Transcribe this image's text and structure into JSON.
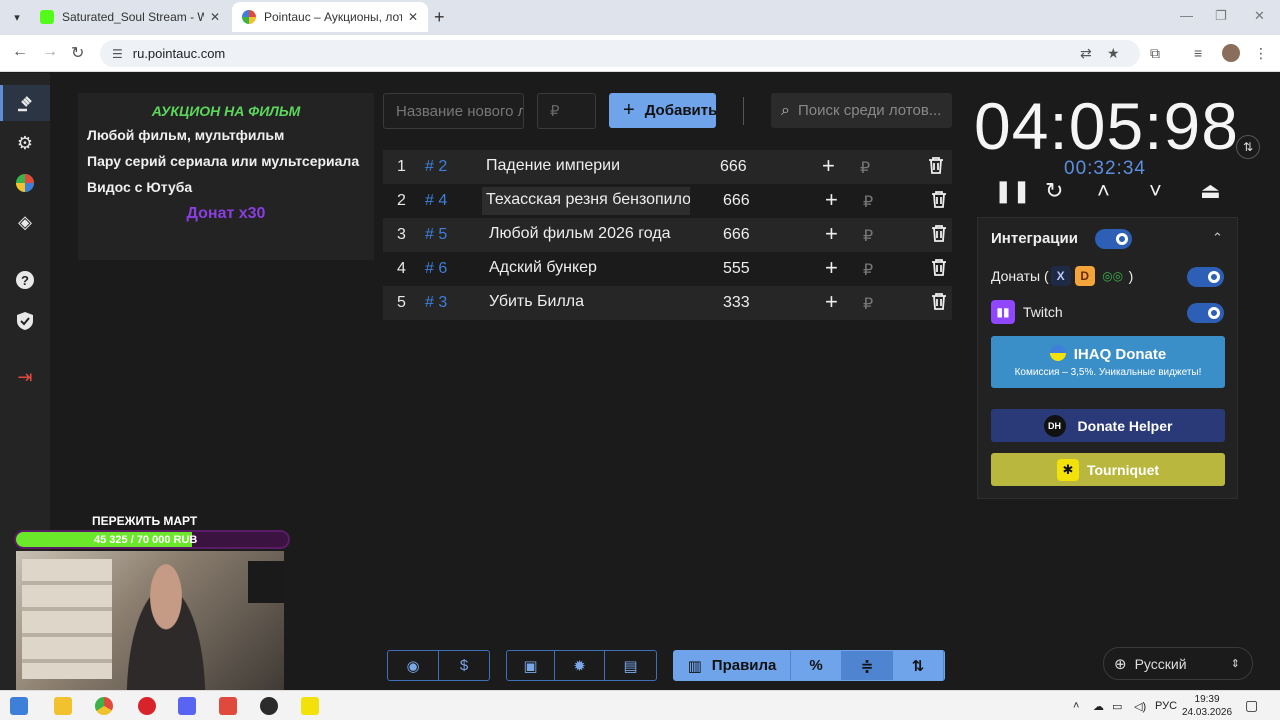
{
  "browser": {
    "tabs": [
      {
        "title": "Saturated_Soul Stream - Watch",
        "favicon_color": "#53fc18"
      },
      {
        "title": "Pointauc – Аукционы, лотереи",
        "favicon_color": "#e04a3c"
      }
    ],
    "url": "ru.pointauc.com"
  },
  "nav": {
    "items": [
      "auction-icon",
      "settings-icon",
      "wheel-icon",
      "layers-icon",
      "help-icon",
      "shield-icon",
      "logout-icon"
    ]
  },
  "note": {
    "heading": "АУКЦИОН НА ФИЛЬМ",
    "lines": [
      "Любой фильм, мультфильм",
      "Пару серий сериала или мультсериала",
      "Видос с Ютуба"
    ],
    "donate": "Донат х30"
  },
  "controls": {
    "name_placeholder": "Название нового лота",
    "amount_placeholder": "₽",
    "add_label": "Добавить",
    "search_placeholder": "Поиск среди лотов..."
  },
  "lots": [
    {
      "rank": "1",
      "id": "# 2",
      "name": "Падение империи",
      "amount": "666",
      "currency": "₽"
    },
    {
      "rank": "2",
      "id": "# 4",
      "name": "Техасская резня бензопилой",
      "amount": "666",
      "currency": "₽"
    },
    {
      "rank": "3",
      "id": "# 5",
      "name": "Любой фильм 2026 года",
      "amount": "666",
      "currency": "₽"
    },
    {
      "rank": "4",
      "id": "# 6",
      "name": "Адский бункер",
      "amount": "555",
      "currency": "₽"
    },
    {
      "rank": "5",
      "id": "# 3",
      "name": "Убить Билла",
      "amount": "333",
      "currency": "₽"
    }
  ],
  "timer": {
    "main": "04:05:98",
    "sub": "00:32:34"
  },
  "integrations": {
    "title": "Интеграции",
    "donations_label": "Донаты (",
    "donations_close": ")",
    "twitch_label": "Twitch",
    "ihaq_title": "IHAQ Donate",
    "ihaq_sub": "Комиссия – 3,5%. Уникальные виджеты!",
    "donate_helper": "Donate Helper",
    "donate_helper_logo": "DH",
    "tourniquet": "Tourniquet",
    "toggles_on": [
      true,
      true,
      true
    ]
  },
  "stream_overlay": {
    "goal_title": "ПЕРЕЖИТЬ МАРТ",
    "goal_text": "45 325 / 70 000 RUB",
    "goal_fraction": 0.647
  },
  "toolbar": {
    "rules_label": "Правила",
    "percent_label": "%"
  },
  "language": {
    "selected": "Русский"
  },
  "taskbar": {
    "lang": "РУС",
    "time": "19:39",
    "date": "24.03.2026"
  },
  "colors": {
    "accent": "#6fa3ea",
    "lot_id": "#3d7fd9",
    "note_heading": "#5cd65c",
    "note_donate": "#8a3ee0",
    "toggle": "#2c5fb5"
  }
}
